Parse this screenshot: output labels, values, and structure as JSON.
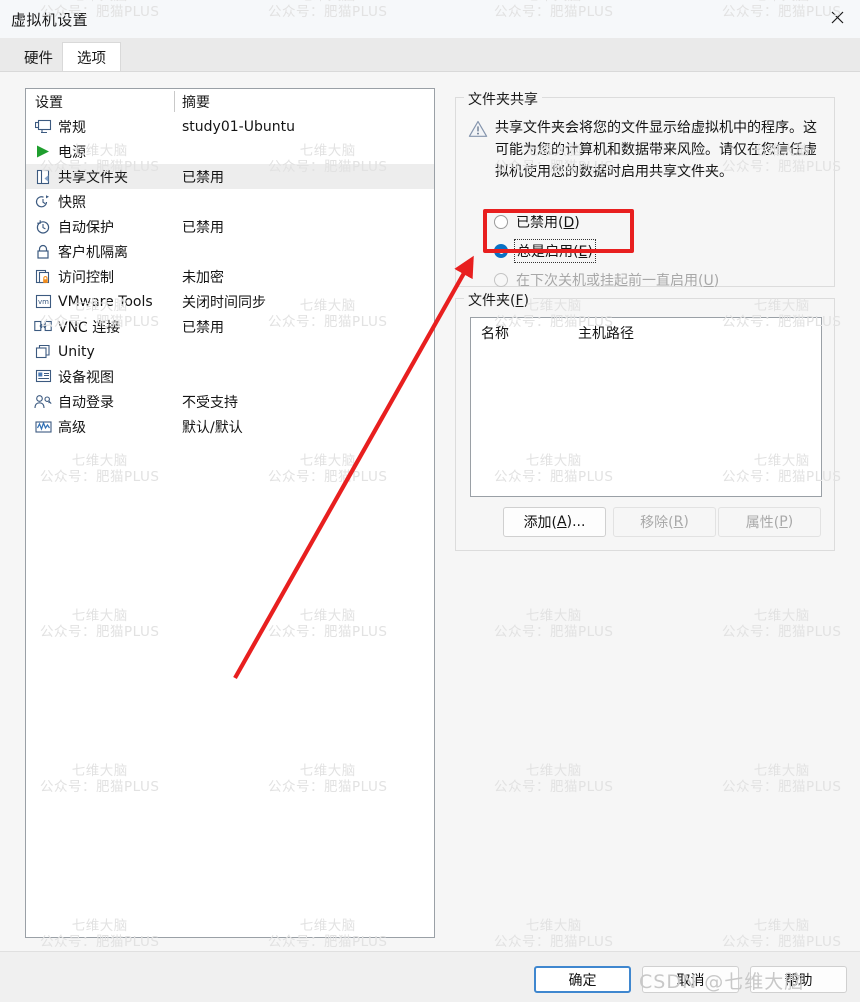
{
  "window": {
    "title": "虚拟机设置",
    "close_icon": "close-icon"
  },
  "tabs": [
    {
      "label": "硬件",
      "active": false
    },
    {
      "label": "选项",
      "active": true
    }
  ],
  "settings_list": {
    "columns": [
      "设置",
      "摘要"
    ],
    "rows": [
      {
        "icon": "monitor-icon",
        "label": "常规",
        "summary": "study01-Ubuntu",
        "selected": false
      },
      {
        "icon": "play-triangle-icon",
        "label": "电源",
        "summary": "",
        "selected": false
      },
      {
        "icon": "shared-folder-icon",
        "label": "共享文件夹",
        "summary": "已禁用",
        "selected": true
      },
      {
        "icon": "snapshot-clock-icon",
        "label": "快照",
        "summary": "",
        "selected": false
      },
      {
        "icon": "autoprotect-icon",
        "label": "自动保护",
        "summary": "已禁用",
        "selected": false
      },
      {
        "icon": "lock-icon",
        "label": "客户机隔离",
        "summary": "",
        "selected": false
      },
      {
        "icon": "access-control-icon",
        "label": "访问控制",
        "summary": "未加密",
        "selected": false
      },
      {
        "icon": "vmware-tools-icon",
        "label": "VMware Tools",
        "summary": "关闭时间同步",
        "selected": false
      },
      {
        "icon": "vnc-icon",
        "label": "VNC 连接",
        "summary": "已禁用",
        "selected": false
      },
      {
        "icon": "unity-icon",
        "label": "Unity",
        "summary": "",
        "selected": false
      },
      {
        "icon": "device-view-icon",
        "label": "设备视图",
        "summary": "",
        "selected": false
      },
      {
        "icon": "autologin-icon",
        "label": "自动登录",
        "summary": "不受支持",
        "selected": false
      },
      {
        "icon": "advanced-icon",
        "label": "高级",
        "summary": "默认/默认",
        "selected": false
      }
    ]
  },
  "folder_sharing": {
    "group_title": "文件夹共享",
    "warning_icon": "warning-triangle-icon",
    "warning_text": "共享文件夹会将您的文件显示给虚拟机中的程序。这可能为您的计算机和数据带来风险。请仅在您信任虚拟机使用您的数据时启用共享文件夹。",
    "options": [
      {
        "label_main": "已禁用(",
        "mnemonic": "D",
        "label_end": ")",
        "checked": false,
        "disabled": false,
        "focused": false
      },
      {
        "label_main": "总是启用(",
        "mnemonic": "E",
        "label_end": ")",
        "checked": true,
        "disabled": false,
        "focused": true
      },
      {
        "label_main": "在下次关机或挂起前一直启用(",
        "mnemonic": "U",
        "label_end": ")",
        "checked": false,
        "disabled": true,
        "focused": false
      }
    ]
  },
  "folders": {
    "group_title_main": "文件夹(",
    "group_title_mnemonic": "F",
    "group_title_end": ")",
    "columns": [
      "名称",
      "主机路径"
    ],
    "rows": [],
    "buttons": [
      {
        "label_main": "添加(",
        "mnemonic": "A",
        "label_end": ")...",
        "disabled": false
      },
      {
        "label_main": "移除(",
        "mnemonic": "R",
        "label_end": ")",
        "disabled": true
      },
      {
        "label_main": "属性(",
        "mnemonic": "P",
        "label_end": ")",
        "disabled": true
      }
    ]
  },
  "footer_buttons": [
    {
      "label": "确定",
      "default": true
    },
    {
      "label": "取消",
      "default": false
    },
    {
      "label": "帮助",
      "default": false
    }
  ],
  "watermark": {
    "line1": "七维大脑",
    "line2": "公众号：肥猫PLUS",
    "csdn": "CSDN @七维大脑"
  },
  "annotations": {
    "highlight_color": "#e81f1f",
    "arrow_color": "#e81f1f"
  }
}
